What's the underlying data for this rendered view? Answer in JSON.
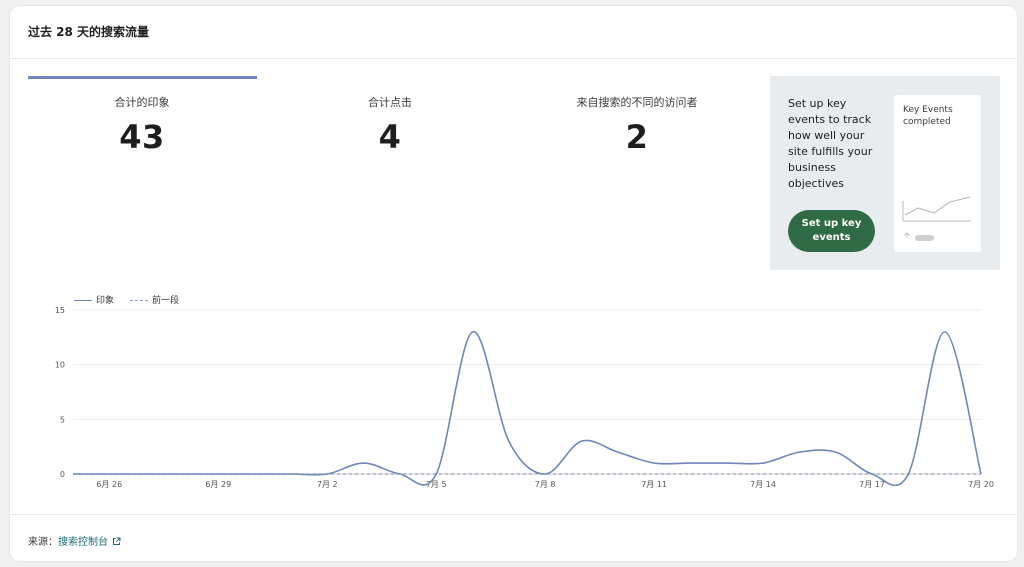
{
  "card": {
    "title": "过去 28 天的搜索流量"
  },
  "metrics": [
    {
      "label": "合计的印象",
      "value": "43"
    },
    {
      "label": "合计点击",
      "value": "4"
    },
    {
      "label": "来自搜索的不同的访问者",
      "value": "2"
    }
  ],
  "promo": {
    "text": "Set up key events to track how well your site fulfills your business objectives",
    "button_label": "Set up key events",
    "mini_card_title": "Key Events completed"
  },
  "legend": {
    "series_1": "印象",
    "series_2": "前一段"
  },
  "footer": {
    "source_prefix": "来源：",
    "source_link": "搜索控制台"
  },
  "colors": {
    "series_1": "#6f86b8",
    "series_2": "#8fa0c8",
    "accent_button": "#2f6b44",
    "link": "#1a6b73"
  },
  "chart_data": {
    "type": "line",
    "x": [
      "6月25",
      "6月26",
      "6月27",
      "6月28",
      "6月29",
      "6月30",
      "7月1",
      "7月2",
      "7月3",
      "7月4",
      "7月5",
      "7月6",
      "7月7",
      "7月8",
      "7月9",
      "7月10",
      "7月11",
      "7月12",
      "7月13",
      "7月14",
      "7月15",
      "7月16",
      "7月17",
      "7月18",
      "7月19",
      "7月20"
    ],
    "x_tick_labels": [
      "6月 26",
      "6月 29",
      "7月 2",
      "7月 5",
      "7月 8",
      "7月 11",
      "7月 14",
      "7月 17",
      "7月 20"
    ],
    "series": [
      {
        "name": "印象",
        "style": "solid",
        "values": [
          0,
          0,
          0,
          0,
          0,
          0,
          0,
          0,
          1,
          0,
          0,
          13,
          3,
          0,
          3,
          2,
          1,
          1,
          1,
          1,
          2,
          2,
          0,
          0,
          13,
          0
        ]
      },
      {
        "name": "前一段",
        "style": "dashed",
        "values": [
          0,
          0,
          0,
          0,
          0,
          0,
          0,
          0,
          0,
          0,
          0,
          0,
          0,
          0,
          0,
          0,
          0,
          0,
          0,
          0,
          0,
          0,
          0,
          0,
          0,
          0
        ]
      }
    ],
    "yticks": [
      0,
      5,
      10,
      15
    ],
    "ylim": [
      0,
      15
    ],
    "legend": "top-left",
    "grid": true
  }
}
